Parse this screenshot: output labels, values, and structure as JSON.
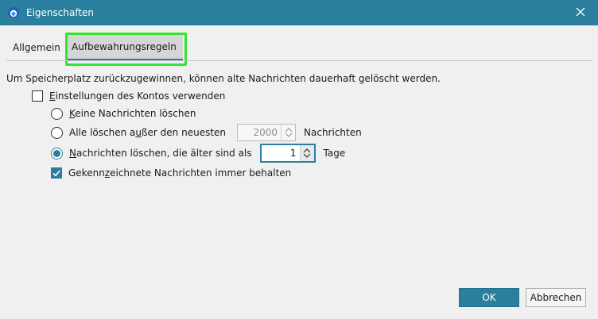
{
  "window": {
    "title": "Eigenschaften",
    "app_icon": "thunderbird-icon",
    "close_icon": "close-icon"
  },
  "tabs": [
    {
      "label": "Allgemein",
      "selected": false
    },
    {
      "label": "Aufbewahrungsregeln",
      "selected": true
    }
  ],
  "description": "Um Speicherplatz zurückzugewinnen, können alte Nachrichten dauerhaft gelöscht werden.",
  "options": {
    "use_account": {
      "pre": "",
      "ul": "E",
      "post": "instellungen des Kontos verwenden",
      "checked": false
    },
    "keep_all": {
      "pre": "",
      "ul": "K",
      "post": "eine Nachrichten löschen",
      "selected": false
    },
    "delete_except": {
      "pre": "Alle löschen a",
      "ul": "u",
      "post": "ßer den neuesten",
      "value": "2000",
      "suffix": "Nachrichten",
      "selected": false
    },
    "delete_older": {
      "pre": "",
      "ul": "N",
      "post": "achrichten löschen, die älter sind als",
      "value": "1",
      "suffix": "Tage",
      "selected": true
    },
    "keep_flagged": {
      "pre": "Gekenn",
      "ul": "z",
      "post": "eichnete Nachrichten immer behalten",
      "checked": true
    }
  },
  "buttons": {
    "ok": "OK",
    "cancel": "Abbrechen"
  },
  "colors": {
    "accent": "#2b7f9e",
    "highlight": "#33e333"
  }
}
